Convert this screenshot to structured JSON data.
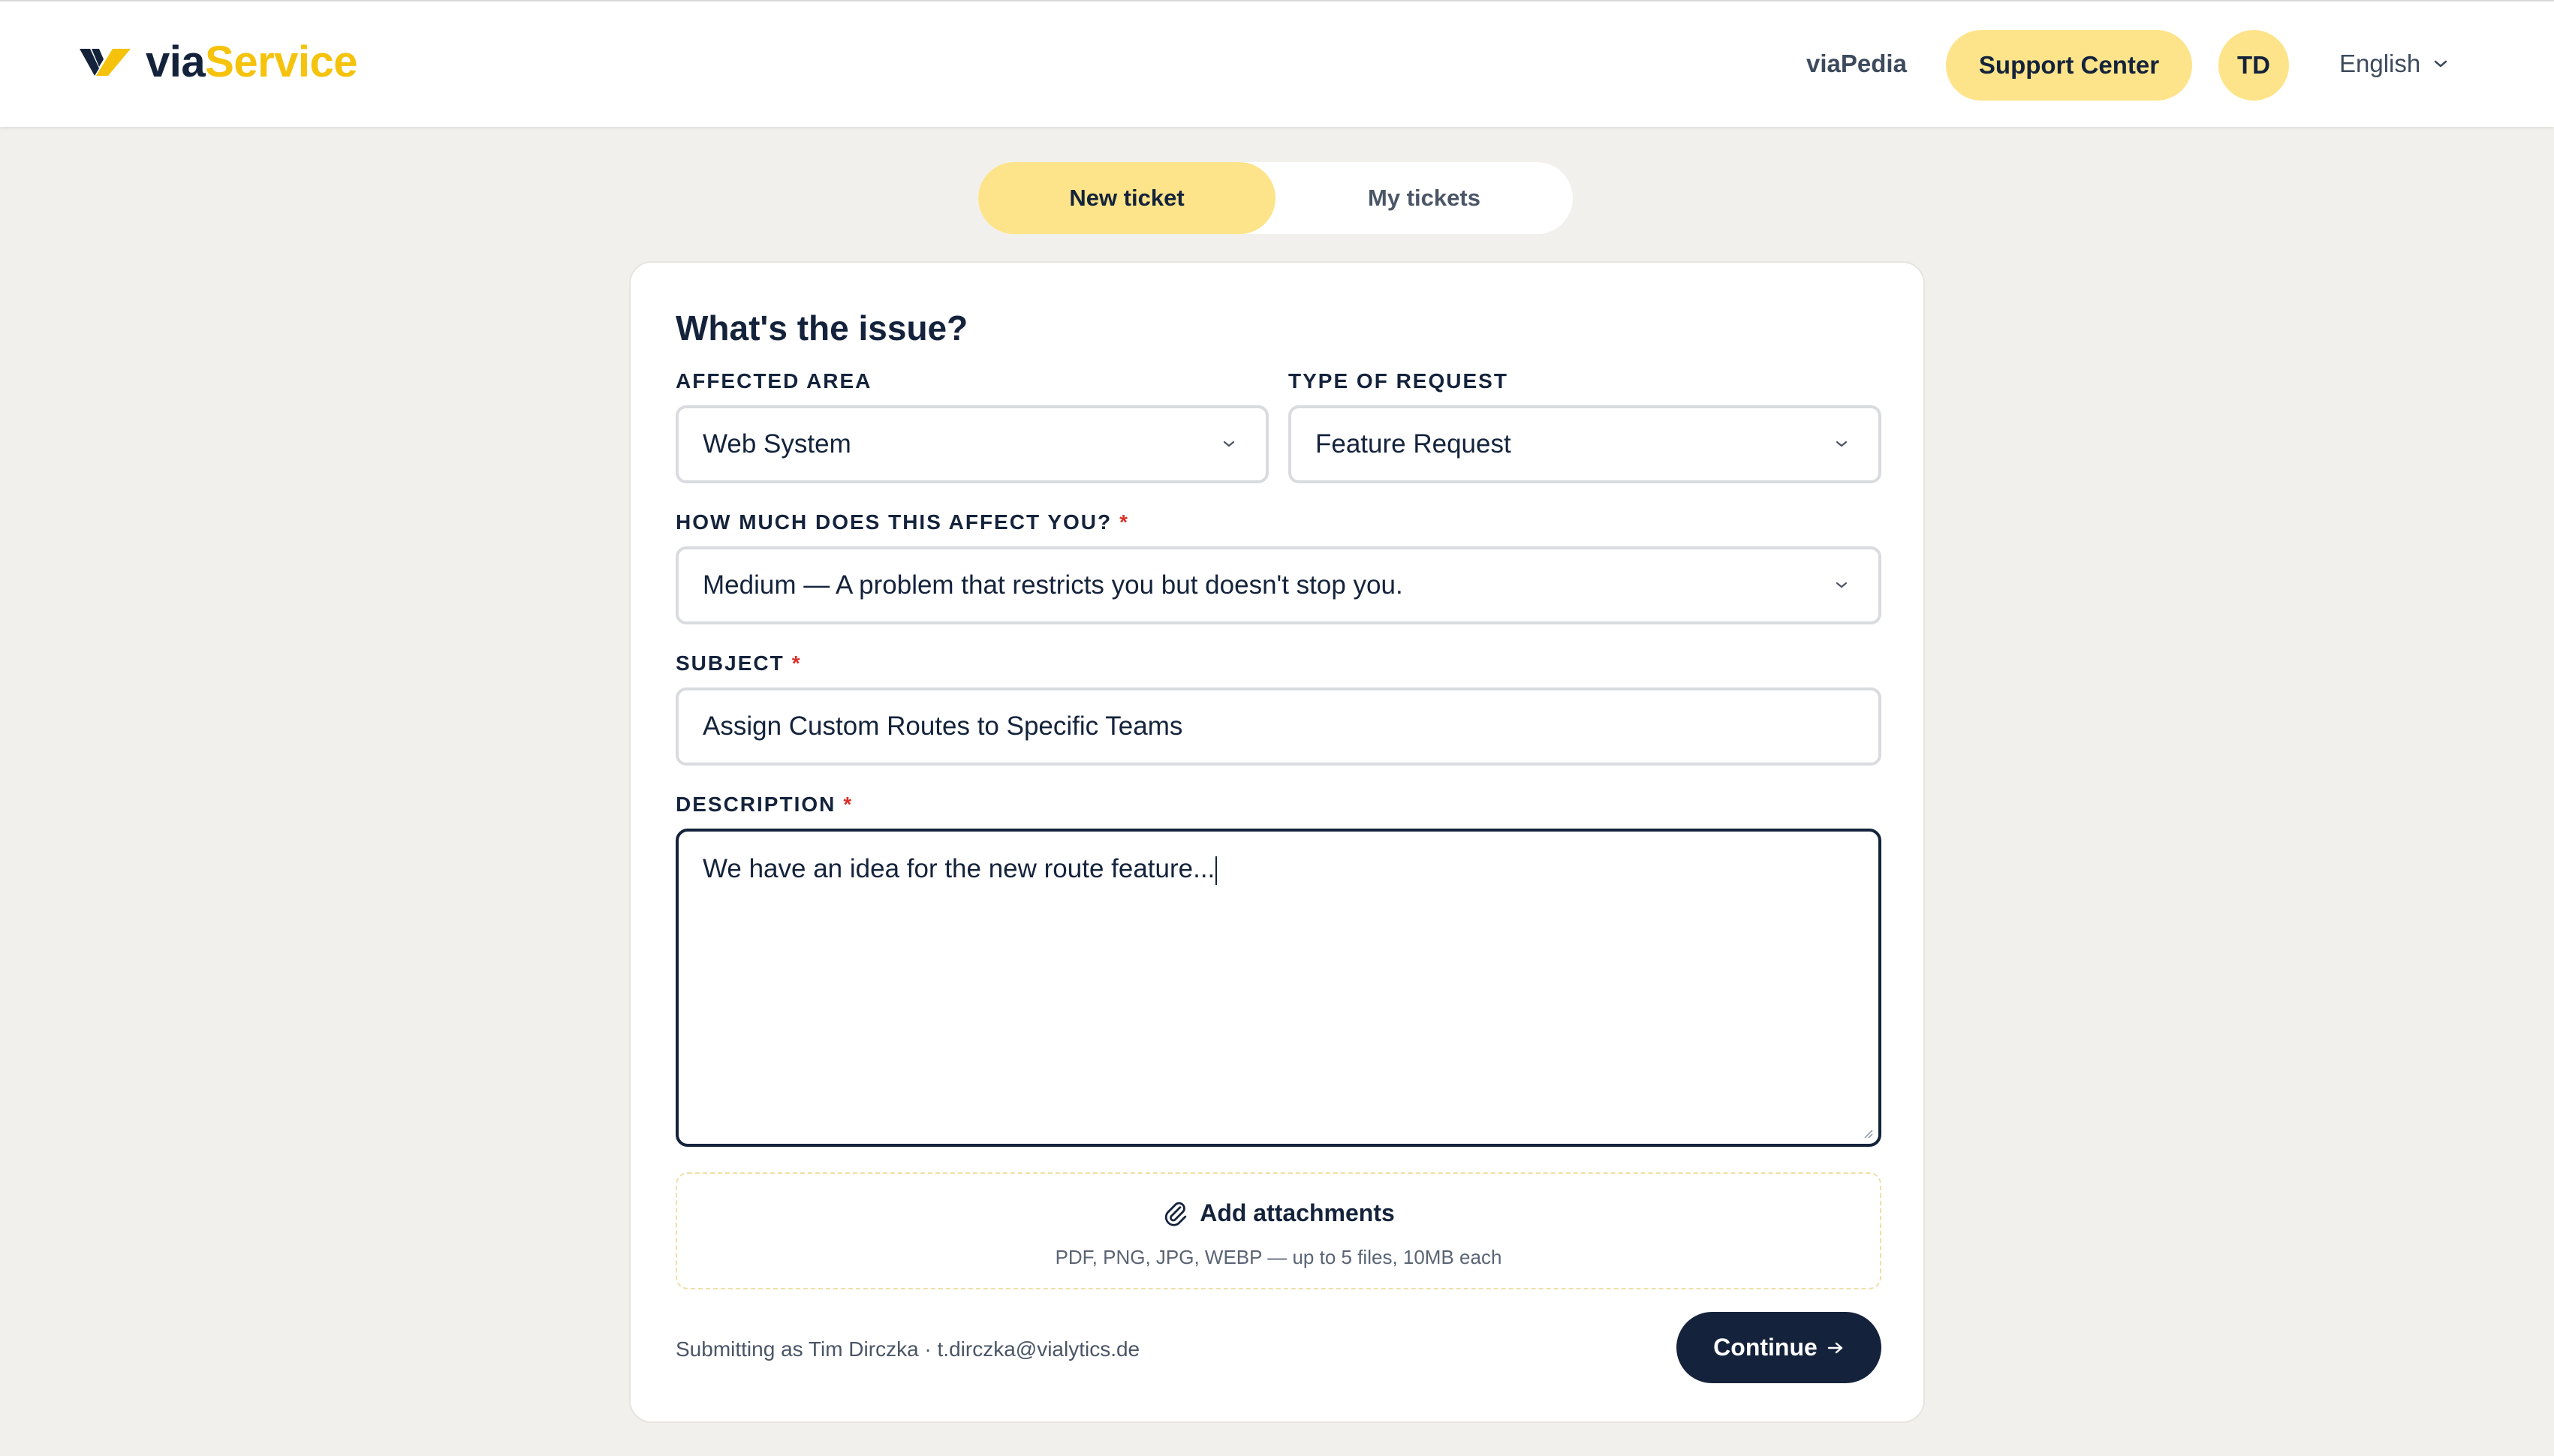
{
  "header": {
    "logo": {
      "part1": "via",
      "part2": "Service"
    },
    "nav_link": "viaPedia",
    "support_button": "Support Center",
    "avatar_initials": "TD",
    "language": "English"
  },
  "tabs": [
    {
      "label": "New ticket",
      "active": true
    },
    {
      "label": "My tickets",
      "active": false
    }
  ],
  "form": {
    "heading": "What's the issue?",
    "affected_area": {
      "label": "AFFECTED AREA",
      "value": "Web System"
    },
    "request_type": {
      "label": "TYPE OF REQUEST",
      "value": "Feature Request"
    },
    "impact": {
      "label": "HOW MUCH DOES THIS AFFECT YOU?",
      "required_mark": "*",
      "value": "Medium — A problem that restricts you but doesn't stop you."
    },
    "subject": {
      "label": "SUBJECT",
      "required_mark": "*",
      "value": "Assign Custom Routes to Specific Teams"
    },
    "description": {
      "label": "DESCRIPTION",
      "required_mark": "*",
      "value": "We have an idea for the new route feature..."
    },
    "attachments": {
      "title": "Add attachments",
      "hint": "PDF, PNG, JPG, WEBP — up to 5 files, 10MB each"
    },
    "submitter": "Submitting as Tim Dirczka · t.dirczka@vialytics.de",
    "continue_button": "Continue"
  },
  "colors": {
    "accent_yellow": "#fde48a",
    "brand_yellow": "#f5c20c",
    "navy": "#14233b",
    "background": "#f1f0ec",
    "required_red": "#d8332b"
  },
  "icons": [
    "brand-logo-icon",
    "chevron-down-icon",
    "paperclip-icon",
    "arrow-right-icon"
  ]
}
